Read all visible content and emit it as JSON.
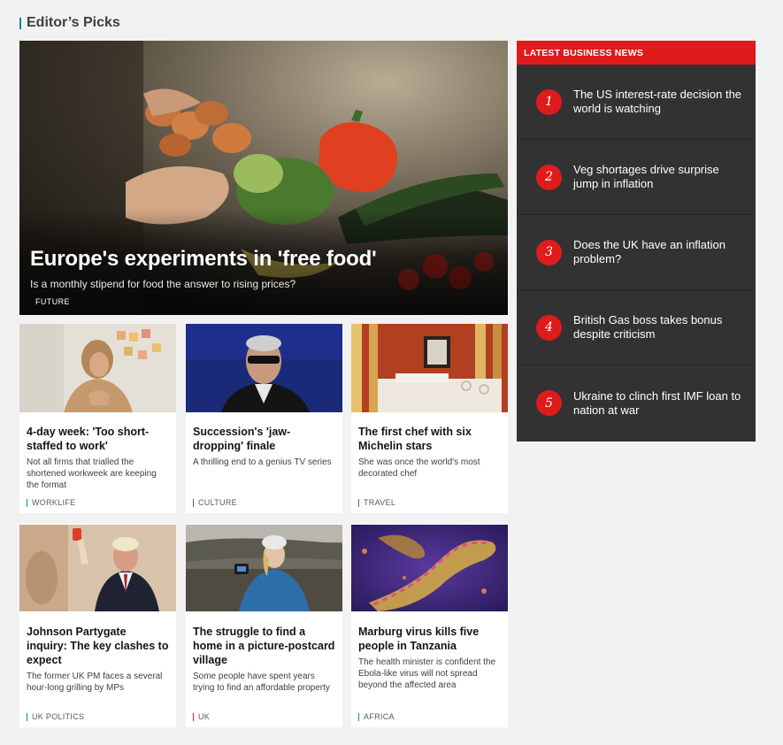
{
  "section": {
    "title": "Editor’s Picks",
    "accent": "#1380a1"
  },
  "hero": {
    "title": "Europe's experiments in 'free food'",
    "summary": "Is a monthly stipend for food the answer to rising prices?",
    "tag": "FUTURE"
  },
  "cards": [
    {
      "title": "4-day week: 'Too short-staffed to work'",
      "summary": "Not all firms that trialled the shortened workweek are keeping the format",
      "tag": "WORKLIFE",
      "tag_color": "#1380a1"
    },
    {
      "title": "Succession's 'jaw-dropping' finale",
      "summary": "A thrilling end to a genius TV series",
      "tag": "CULTURE",
      "tag_color": "#8b3a8b"
    },
    {
      "title": "The first chef with six Michelin stars",
      "summary": "She was once the world's most decorated chef",
      "tag": "TRAVEL",
      "tag_color": "#2e8b57"
    },
    {
      "title": "Johnson Partygate inquiry: The key clashes to expect",
      "summary": "The former UK PM faces a several hour-long grilling by MPs",
      "tag": "UK POLITICS",
      "tag_color": "#1380a1"
    },
    {
      "title": "The struggle to find a home in a picture-postcard village",
      "summary": "Some people have spent years trying to find an affordable property",
      "tag": "UK",
      "tag_color": "#e01b1b"
    },
    {
      "title": "Marburg virus kills five people in Tanzania",
      "summary": "The health minister is confident the Ebola-like virus will not spread beyond the affected area",
      "tag": "AFRICA",
      "tag_color": "#1380a1"
    }
  ],
  "latest": {
    "heading": "LATEST BUSINESS NEWS",
    "accent": "#e01b1b",
    "items": [
      {
        "num": "1",
        "text": "The US interest-rate decision the world is watching"
      },
      {
        "num": "2",
        "text": "Veg shortages drive surprise jump in inflation"
      },
      {
        "num": "3",
        "text": "Does the UK have an inflation problem?"
      },
      {
        "num": "4",
        "text": "British Gas boss takes bonus despite criticism"
      },
      {
        "num": "5",
        "text": "Ukraine to clinch first IMF loan to nation at war"
      }
    ]
  }
}
